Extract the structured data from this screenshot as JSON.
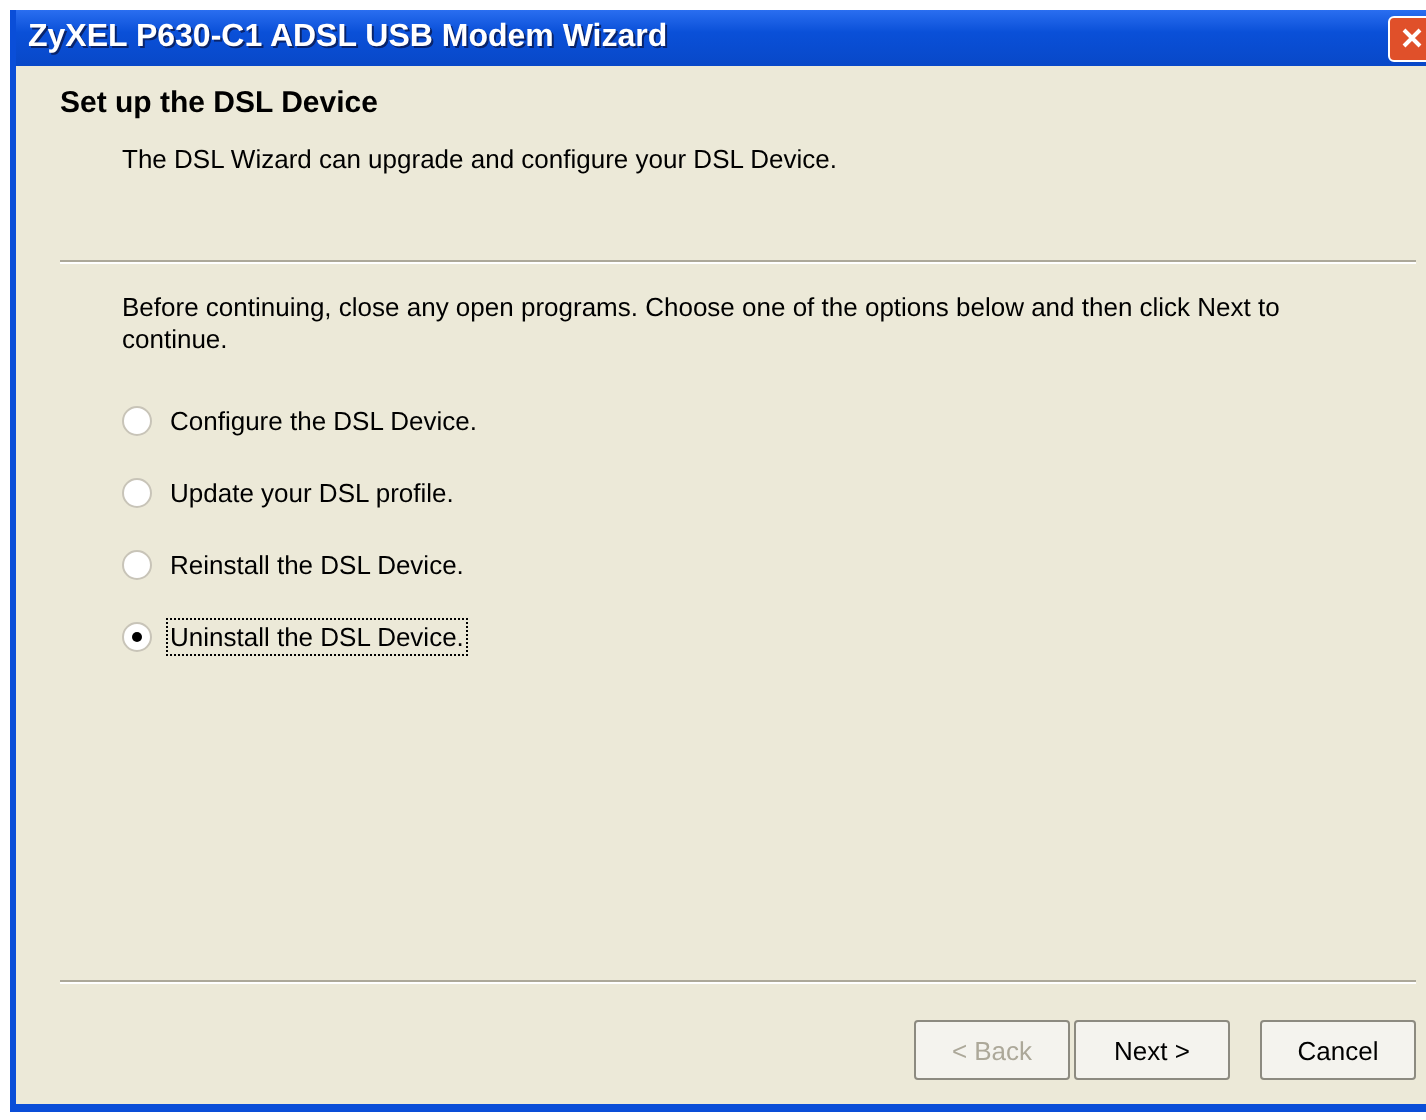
{
  "window": {
    "title": "ZyXEL P630-C1 ADSL USB Modem Wizard"
  },
  "header": {
    "title": "Set up the DSL Device",
    "subtitle": "The DSL Wizard can upgrade and configure your DSL Device."
  },
  "instructions": "Before continuing, close any open programs.  Choose one of the options below and then click Next to continue.",
  "options": [
    {
      "label": "Configure the DSL Device.",
      "selected": false
    },
    {
      "label": "Update your DSL profile.",
      "selected": false
    },
    {
      "label": "Reinstall the DSL Device.",
      "selected": false
    },
    {
      "label": "Uninstall the DSL Device.",
      "selected": true
    }
  ],
  "buttons": [
    {
      "label": "< Back",
      "disabled": true
    },
    {
      "label": "Next >",
      "disabled": false
    },
    {
      "label": "Cancel",
      "disabled": false
    }
  ]
}
